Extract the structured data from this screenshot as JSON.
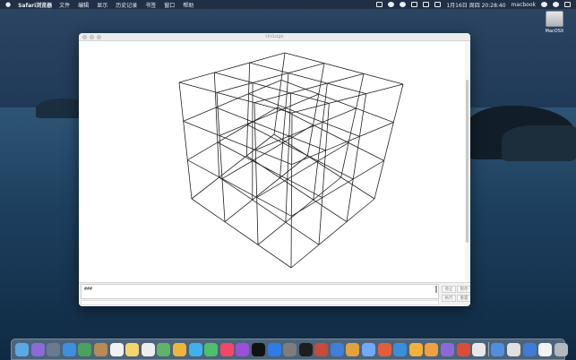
{
  "menubar": {
    "app_name": "Safari浏览器",
    "items": [
      "文件",
      "编辑",
      "显示",
      "历史记录",
      "书签",
      "窗口",
      "帮助"
    ],
    "clock": "1月16日 周四 20:28:40",
    "user": "macbook"
  },
  "desktop": {
    "drive_label": "MacOSX"
  },
  "window": {
    "title": "UniLogo",
    "code": "###",
    "buttons": {
      "stop": "停止",
      "pause": "暂停",
      "run": "执行",
      "reset": "重置"
    }
  },
  "dock": {
    "icons": [
      "finder-icon",
      "siri-icon",
      "launchpad-icon",
      "safari-icon",
      "photos-app-icon",
      "contacts-icon",
      "calendar-icon",
      "notes-icon",
      "reminders-icon",
      "maps-icon",
      "photos-icon",
      "messages-icon",
      "facetime-icon",
      "music-icon",
      "podcasts-icon",
      "appletv-icon",
      "appstore-icon",
      "system-preferences-icon",
      "terminal-icon",
      "app-icon-1",
      "app-icon-2",
      "app-icon-3",
      "app-icon-4",
      "app-icon-5",
      "app-icon-6",
      "app-icon-7",
      "app-icon-8",
      "app-icon-9",
      "app-icon-10",
      "app-icon-11",
      "downloads-icon",
      "app-icon-12",
      "app-icon-13",
      "app-icon-14",
      "trash-icon"
    ]
  }
}
